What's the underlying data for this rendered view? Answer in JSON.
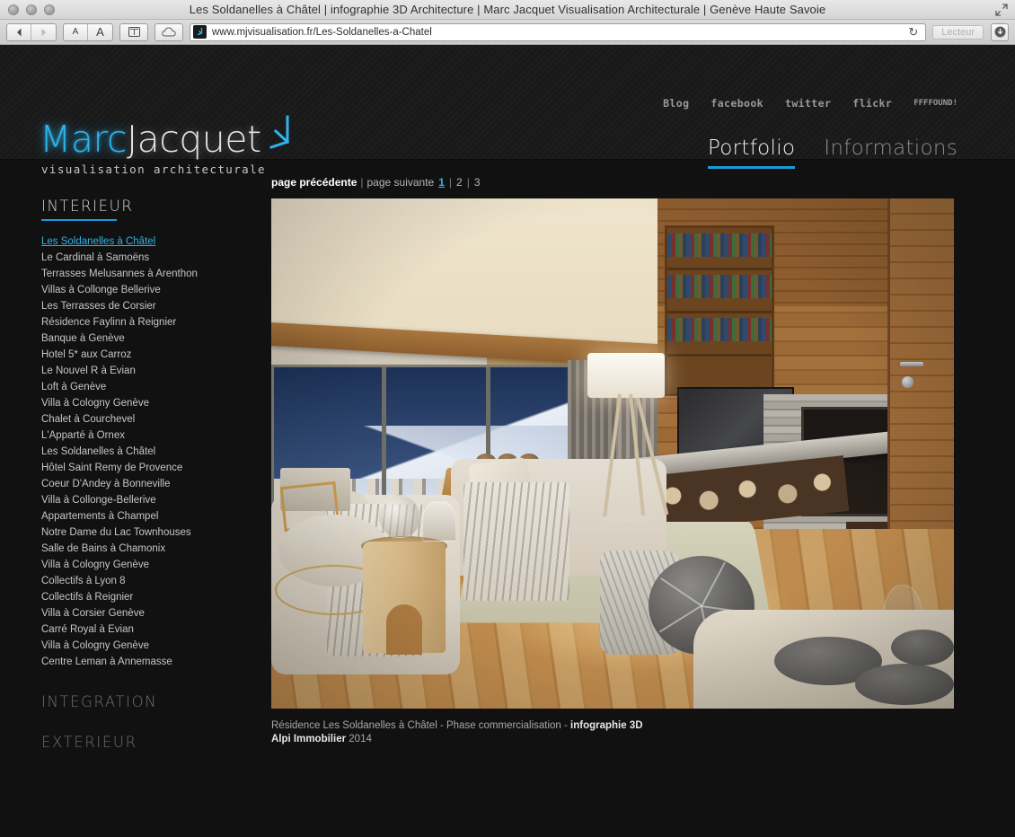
{
  "browser": {
    "window_title": "Les Soldanelles à Châtel | infographie 3D Architecture | Marc Jacquet Visualisation Architecturale | Genève Haute Savoie",
    "url": "www.mjvisualisation.fr/Les-Soldanelles-a-Chatel",
    "reader_label": "Lecteur",
    "toolbar_icons": {
      "back": "back-arrow-icon",
      "forward": "forward-arrow-icon",
      "text_smaller": "A",
      "text_larger": "A",
      "reader_toggle": "book-icon",
      "cloud": "icloud-icon",
      "reload": "reload-icon",
      "downloads": "download-icon",
      "fullscreen": "fullscreen-icon"
    }
  },
  "site": {
    "logo": {
      "first": "Marc",
      "second": "Jacquet",
      "tagline": "visualisation architecturale",
      "accent_color": "#2fb3ec"
    },
    "social_links": [
      {
        "label": "Blog"
      },
      {
        "label": "facebook"
      },
      {
        "label": "twitter"
      },
      {
        "label": "flickr"
      },
      {
        "label": "FFFFOUND!"
      }
    ],
    "nav": [
      {
        "label": "Portfolio",
        "active": true
      },
      {
        "label": "Informations",
        "active": false
      }
    ]
  },
  "sidebar": {
    "sections": [
      {
        "heading": "INTERIEUR",
        "active": true,
        "items": [
          {
            "label": "Les Soldanelles à Châtel",
            "active": true
          },
          {
            "label": "Le Cardinal à Samoëns",
            "active": false
          },
          {
            "label": "Terrasses Melusannes à Arenthon",
            "active": false
          },
          {
            "label": "Villas à Collonge Bellerive",
            "active": false
          },
          {
            "label": "Les Terrasses de Corsier",
            "active": false
          },
          {
            "label": "Résidence Faylinn à Reignier",
            "active": false
          },
          {
            "label": "Banque à Genève",
            "active": false
          },
          {
            "label": "Hotel 5* aux Carroz",
            "active": false
          },
          {
            "label": "Le Nouvel R à Evian",
            "active": false
          },
          {
            "label": "Loft à Genève",
            "active": false
          },
          {
            "label": "Villa à Cologny Genève",
            "active": false
          },
          {
            "label": "Chalet à Courchevel",
            "active": false
          },
          {
            "label": "L'Apparté à Ornex",
            "active": false
          },
          {
            "label": "Les Soldanelles à Châtel",
            "active": false
          },
          {
            "label": "Hôtel Saint Remy de Provence",
            "active": false
          },
          {
            "label": "Coeur D'Andey à Bonneville",
            "active": false
          },
          {
            "label": "Villa à Collonge-Bellerive",
            "active": false
          },
          {
            "label": "Appartements à Champel",
            "active": false
          },
          {
            "label": "Notre Dame du Lac Townhouses",
            "active": false
          },
          {
            "label": "Salle de Bains à Chamonix",
            "active": false
          },
          {
            "label": "Villa à Cologny Genève",
            "active": false
          },
          {
            "label": "Collectifs à Lyon 8",
            "active": false
          },
          {
            "label": "Collectifs à Reignier",
            "active": false
          },
          {
            "label": "Villa à Corsier Genève",
            "active": false
          },
          {
            "label": "Carré Royal à Evian",
            "active": false
          },
          {
            "label": "Villa à Cologny Genève",
            "active": false
          },
          {
            "label": "Centre Leman à Annemasse",
            "active": false
          }
        ]
      },
      {
        "heading": "INTEGRATION",
        "active": false,
        "items": []
      },
      {
        "heading": "EXTERIEUR",
        "active": false,
        "items": []
      }
    ]
  },
  "pagination": {
    "previous": "page précédente",
    "separator": "|",
    "next": "page suivante",
    "pages": [
      {
        "label": "1",
        "active": true
      },
      {
        "label": "2",
        "active": false
      },
      {
        "label": "3",
        "active": false
      }
    ]
  },
  "gallery": {
    "image_alt": "Intérieur de chalet — salon avec cheminée en pierre, vue sur montagne enneigée",
    "caption_line1_prefix": "Résidence Les Soldanelles à Châtel - Phase commercialisation - ",
    "caption_line1_bold": "infographie 3D",
    "caption_line2_bold": "Alpi Immobilier",
    "caption_line2_year": " 2014"
  }
}
